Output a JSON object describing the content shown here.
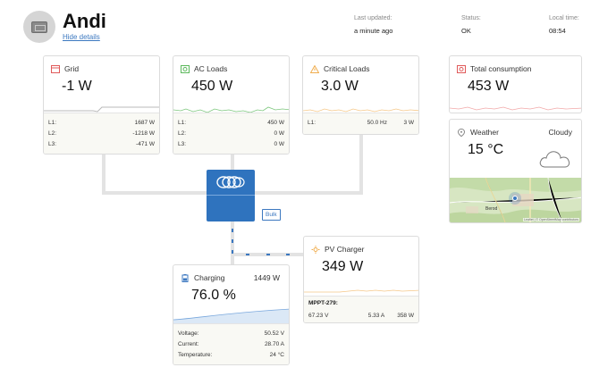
{
  "header": {
    "site_name": "Andi",
    "hide_details": "Hide details",
    "last_updated_label": "Last updated:",
    "last_updated_value": "a minute ago",
    "status_label": "Status:",
    "status_value": "OK",
    "local_time_label": "Local time:",
    "local_time_value": "08:54"
  },
  "grid": {
    "title": "Grid",
    "value": "-1 W",
    "rows": [
      {
        "k": "L1:",
        "v": "1687 W"
      },
      {
        "k": "L2:",
        "v": "-1218 W"
      },
      {
        "k": "L3:",
        "v": "-471 W"
      }
    ]
  },
  "ac_loads": {
    "title": "AC Loads",
    "value": "450 W",
    "rows": [
      {
        "k": "L1:",
        "v": "450 W"
      },
      {
        "k": "L2:",
        "v": "0 W"
      },
      {
        "k": "L3:",
        "v": "0 W"
      }
    ]
  },
  "critical_loads": {
    "title": "Critical Loads",
    "value": "3.0 W",
    "row": {
      "k": "L1:",
      "m": "50.0 Hz",
      "v": "3 W"
    }
  },
  "total_consumption": {
    "title": "Total consumption",
    "value": "453 W"
  },
  "weather": {
    "title": "Weather",
    "condition": "Cloudy",
    "temp": "15 °C",
    "map_attribution": "Leaflet | © OpenStreetMap contributors",
    "map_place": "Berod"
  },
  "inverter": {
    "state": "Bulk"
  },
  "pv_charger": {
    "title": "PV Charger",
    "value": "349 W",
    "device": "MPPT-279:",
    "voltage": "67.23 V",
    "current": "5.33 A",
    "power": "358 W"
  },
  "battery": {
    "title": "Charging",
    "power": "1449 W",
    "soc": "76.0 %",
    "rows": [
      {
        "k": "Voltage:",
        "v": "50.52 V"
      },
      {
        "k": "Current:",
        "v": "28.70 A"
      },
      {
        "k": "Temperature:",
        "v": "24 °C"
      }
    ]
  },
  "colors": {
    "grid": "#e05a5a",
    "ac_loads": "#5cb85c",
    "critical": "#f0ad4e",
    "total": "#e05a5a",
    "inverter": "#2f73be",
    "battery_fill": "#dbe8f6"
  }
}
